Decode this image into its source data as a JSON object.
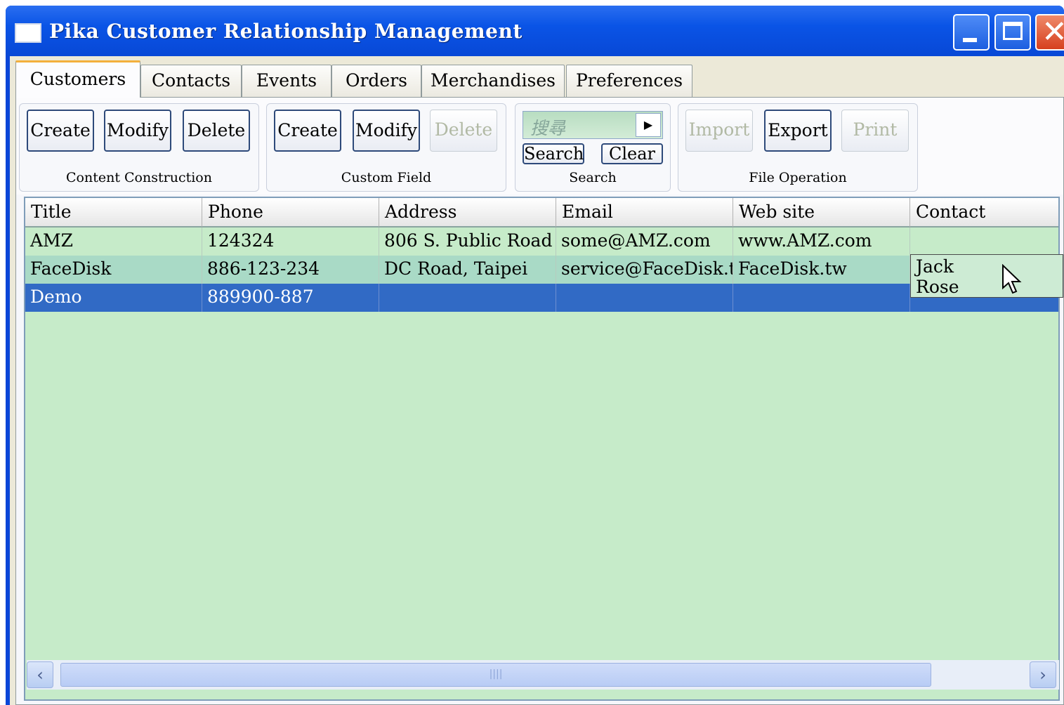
{
  "window": {
    "title": "Pika Customer Relationship Management"
  },
  "tabs": [
    {
      "label": "Customers"
    },
    {
      "label": "Contacts"
    },
    {
      "label": "Events"
    },
    {
      "label": "Orders"
    },
    {
      "label": "Merchandises"
    },
    {
      "label": "Preferences"
    }
  ],
  "toolbar": {
    "content_construction": {
      "create": "Create",
      "modify": "Modify",
      "delete": "Delete",
      "label": "Content Construction"
    },
    "custom_field": {
      "create": "Create",
      "modify": "Modify",
      "delete": "Delete",
      "label": "Custom Field"
    },
    "search": {
      "placeholder": "搜尋",
      "search_btn": "Search",
      "clear_btn": "Clear",
      "label": "Search"
    },
    "file_operation": {
      "import": "Import",
      "export": "Export",
      "print": "Print",
      "label": "File Operation"
    }
  },
  "grid": {
    "columns": [
      "Title",
      "Phone",
      "Address",
      "Email",
      "Web site",
      "Contact"
    ],
    "rows": [
      [
        "AMZ",
        "124324",
        "806 S. Public Road",
        "some@AMZ.com",
        "www.AMZ.com",
        ""
      ],
      [
        "FaceDisk",
        "886-123-234",
        "DC Road, Taipei",
        "service@FaceDisk.t▸",
        "FaceDisk.tw",
        ""
      ],
      [
        "Demo",
        "889900-887",
        "",
        "",
        "",
        ""
      ]
    ],
    "contact_popup": [
      "Jack",
      "Rose"
    ]
  },
  "colors": {
    "grid_bg": "#c6ebc9",
    "selected_row": "#316ac5",
    "titlebar": "#0a54e6"
  }
}
